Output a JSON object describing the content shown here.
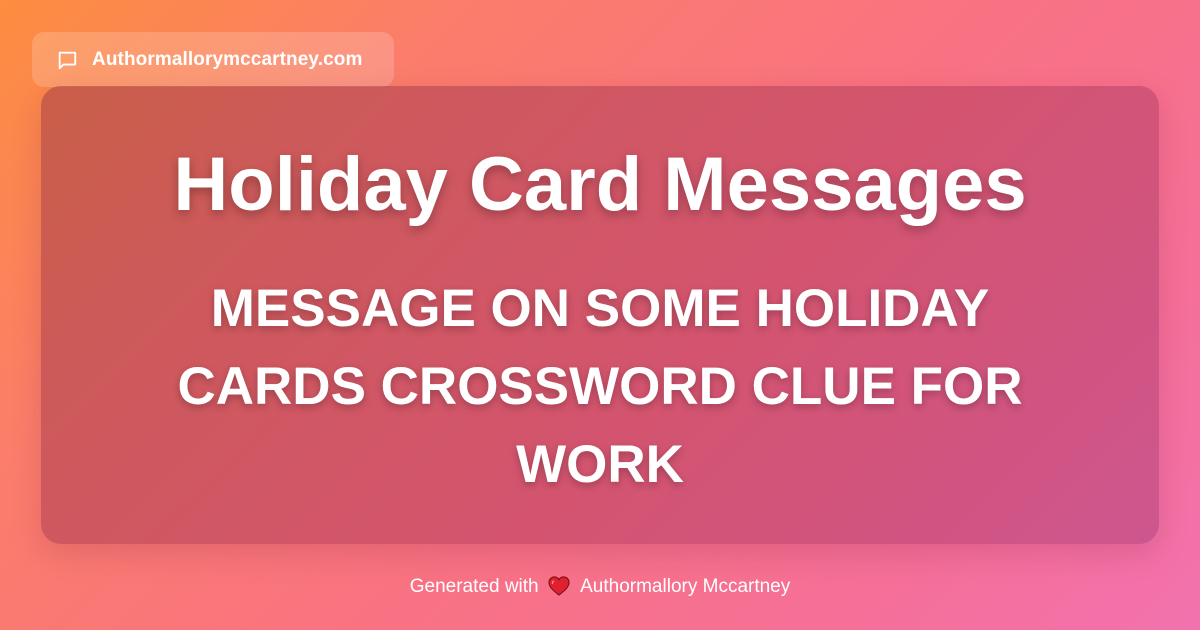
{
  "site_badge": {
    "icon": "chat-bubble-icon",
    "label": "Authormallorymccartney.com"
  },
  "card": {
    "title": "Holiday Card Messages",
    "subtitle": "MESSAGE ON SOME HOLIDAY CARDS CROSSWORD CLUE FOR WORK"
  },
  "footer": {
    "prefix": "Generated with",
    "icon": "heart-icon",
    "author": "Authormallory Mccartney"
  },
  "colors": {
    "background_start": "#fd8d3f",
    "background_end": "#f272ae",
    "text": "#ffffff",
    "heart": "#e0202e"
  }
}
